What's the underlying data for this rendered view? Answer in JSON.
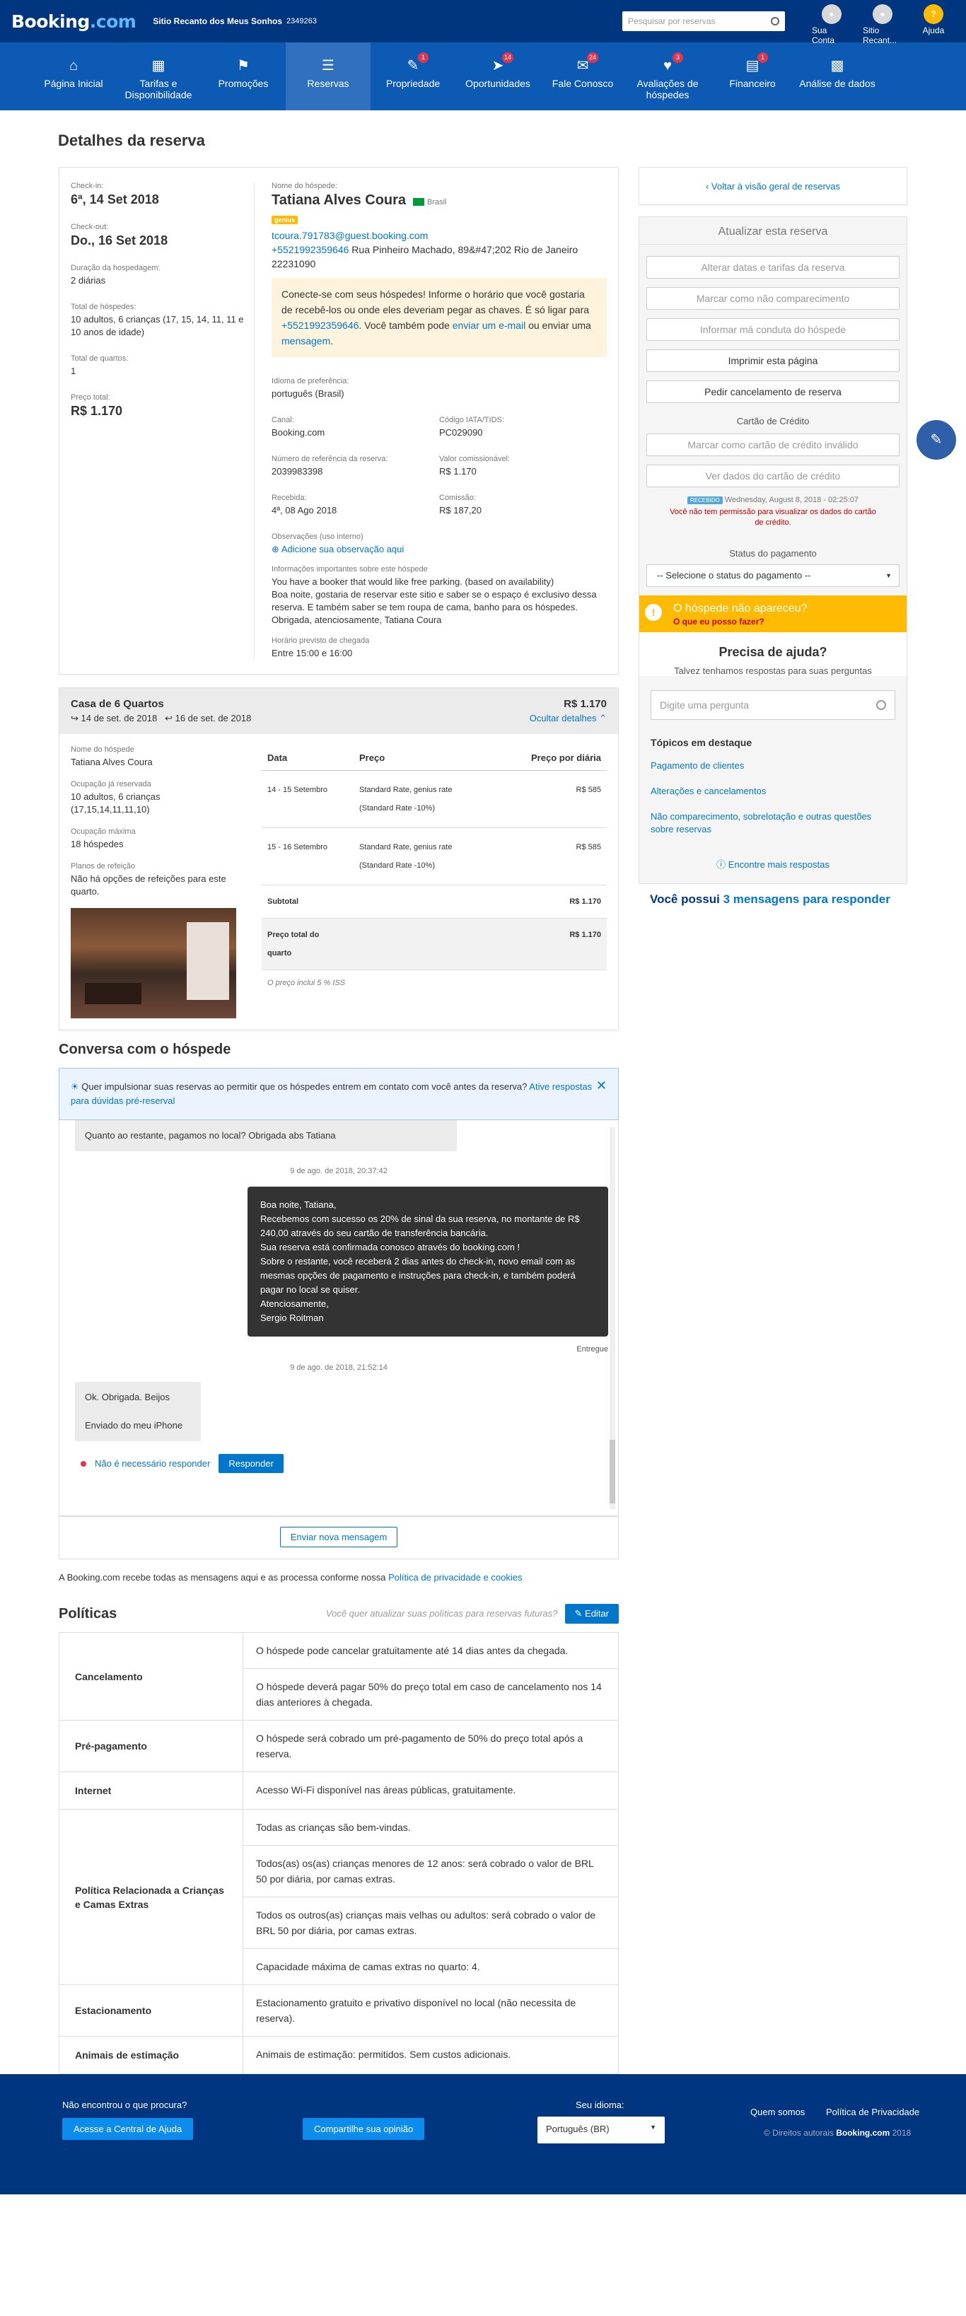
{
  "header": {
    "logo": "Booking",
    "logo_suffix": ".com",
    "property_name": "Sitio Recanto dos Meus Sonhos",
    "property_id": "2349263",
    "search_placeholder": "Pesquisar por reservas",
    "account": "Sua Conta",
    "property_short": "Sitio Recant...",
    "help": "Ajuda"
  },
  "nav": [
    {
      "label": "Página Inicial",
      "icon": "home-icon"
    },
    {
      "label": "Tarifas e Disponibilidade",
      "icon": "calendar-icon"
    },
    {
      "label": "Promoções",
      "icon": "tag-icon"
    },
    {
      "label": "Reservas",
      "icon": "list-icon"
    },
    {
      "label": "Propriedade",
      "icon": "pen-icon",
      "badge": "1"
    },
    {
      "label": "Oportunidades",
      "icon": "rocket-icon",
      "badge": "14"
    },
    {
      "label": "Fale Conosco",
      "icon": "envelope-icon",
      "badge": "24"
    },
    {
      "label": "Avaliações de hóspedes",
      "icon": "heart-icon",
      "badge": "3"
    },
    {
      "label": "Financeiro",
      "icon": "document-icon",
      "badge": "1"
    },
    {
      "label": "Análise de dados",
      "icon": "bar-chart-icon"
    }
  ],
  "page_title": "Detalhes da reserva",
  "reservation": {
    "checkin_label": "Check-in:",
    "checkin": "6ª, 14 Set 2018",
    "checkout_label": "Check-out:",
    "checkout": "Do., 16 Set 2018",
    "duration_label": "Duração da hospedagem:",
    "duration": "2 diárias",
    "guests_label": "Total de hóspedes:",
    "guests": "10 adultos, 6 crianças (17, 15, 14, 11, 11 e 10 anos de idade)",
    "rooms_label": "Total de quartos:",
    "rooms": "1",
    "price_label": "Preço total:",
    "price": "R$ 1.170",
    "guest_name_label": "Nome do hóspede:",
    "guest_name": "Tatiana Alves Coura",
    "country": "Brasil",
    "genius": "genius",
    "email": "tcoura.791783@guest.booking.com",
    "phone": "+5521992359646",
    "address": "Rua Pinheiro Machado, 89&#47;202 Rio de Janeiro 22231090",
    "notice_1": "Conecte-se com seus hóspedes! Informe o horário que você gostaria de recebê-los ou onde eles deveriam pegar as chaves. É só ligar para",
    "notice_phone": "+5521992359646",
    "notice_2": ". Você também pode",
    "notice_link1": "enviar um e-mail",
    "notice_3": "ou enviar uma",
    "notice_link2": "mensagem",
    "lang_label": "Idioma de preferência:",
    "lang": "português (Brasil)",
    "channel_label": "Canal:",
    "channel": "Booking.com",
    "iata_label": "Código IATA/TIDS:",
    "iata": "PC029090",
    "ref_label": "Número de referência da reserva:",
    "ref": "2039983398",
    "commissionable_label": "Valor comissionável:",
    "commissionable": "R$ 1.170",
    "received_label": "Recebida:",
    "received": "4ª, 08 Ago 2018",
    "commission_label": "Comissão:",
    "commission": "R$ 187,20",
    "obs_label": "Observações (uso interno)",
    "obs_link": "Adicione sua observação aqui",
    "info_label": "Informações importantes sobre este hóspede",
    "info": "You have a booker that would like free parking. (based on availability)\nBoa noite, gostaria de reservar este sitio e saber se o espaço é exclusivo dessa reserva.  E também saber se tem roupa de cama, banho para os hóspedes. Obrigada, atenciosamente, Tatiana Coura",
    "arrival_label": "Horário previsto de chegada",
    "arrival": "Entre 15:00 e 16:00"
  },
  "room": {
    "title": "Casa de 6 Quartos",
    "price": "R$ 1.170",
    "from": "14 de set. de 2018",
    "to": "16 de set. de 2018",
    "hide": "Ocultar detalhes",
    "guest_label": "Nome do hóspede",
    "guest": "Tatiana Alves Coura",
    "occ_label": "Ocupação já reservada",
    "occ": "10 adultos, 6 crianças (17,15,14,11,11,10)",
    "max_label": "Ocupação máxima",
    "max": "18 hóspedes",
    "meal_label": "Planos de refeição",
    "meal": "Não há opções de refeições para este quarto.",
    "table_head": [
      "Data",
      "Preço",
      "Preço por diária"
    ],
    "rows": [
      [
        "14 - 15 Setembro",
        "Standard Rate, genius rate (Standard Rate -10%)",
        "R$ 585"
      ],
      [
        "15 - 16 Setembro",
        "Standard Rate, genius rate (Standard Rate -10%)",
        "R$ 585"
      ]
    ],
    "subtotal_label": "Subtotal",
    "subtotal": "R$ 1.170",
    "total_label": "Preço total do quarto",
    "total": "R$ 1.170",
    "tax": "O preço inclui 5 % ISS"
  },
  "conversation": {
    "title": "Conversa com o hóspede",
    "tip": "Quer impulsionar suas reservas ao permitir que os hóspedes entrem em contato com você antes da reserva?",
    "tip_link": "Ative respostas para dúvidas pré-reserval",
    "msg_in_1": "Quanto ao restante, pagamos no local? Obrigada abs Tatiana",
    "ts_1": "9 de ago. de 2018, 20:37:42",
    "msg_out": "Boa noite, Tatiana,\nRecebemos com sucesso os 20% de sinal da sua reserva, no montante de R$ 240,00 através do seu cartão de transferência bancária.\nSua reserva está confirmada conosco através do booking.com !\nSobre o restante, você receberá 2 dias antes do check-in, novo email com as mesmas opções de pagamento e instruções para check-in, e também poderá pagar no local se quiser.\nAtenciosamente,\nSergio Roitman",
    "delivered": "Entregue",
    "ts_2": "9 de ago. de 2018, 21:52:14",
    "msg_in_2": "Ok. Obrigada. Beijos\n\nEnviado do meu iPhone",
    "no_reply": "Não é necessário responder",
    "reply": "Responder",
    "new_msg": "Enviar nova mensagem",
    "privacy": "A Booking.com recebe todas as mensagens aqui e as processa conforme nossa",
    "privacy_link": "Política de privacidade e cookies"
  },
  "policies": {
    "title": "Políticas",
    "hint": "Você quer atualizar suas políticas para reservas futuras?",
    "edit": "Editar",
    "rows": [
      {
        "k": "Cancelamento",
        "v": [
          "O hóspede pode cancelar gratuitamente até 14 dias antes da chegada.",
          "O hóspede deverá pagar 50% do preço total em caso de cancelamento nos 14 dias anteriores à chegada."
        ]
      },
      {
        "k": "Pré-pagamento",
        "v": [
          "O hóspede será cobrado um pré-pagamento de 50% do preço total após a reserva."
        ]
      },
      {
        "k": "Internet",
        "v": [
          "Acesso Wi-Fi disponível nas áreas públicas, gratuitamente."
        ]
      },
      {
        "k": "Política Relacionada a Crianças e Camas Extras",
        "v": [
          "Todas as crianças são bem-vindas.",
          "Todos(as) os(as) crianças menores de 12 anos: será cobrado o valor de BRL 50 por diária, por camas extras.",
          "Todos os outros(as) crianças mais velhas ou adultos: será cobrado o valor de BRL 50 por diária, por camas extras.",
          "Capacidade máxima de camas extras no quarto: 4."
        ]
      },
      {
        "k": "Estacionamento",
        "v": [
          "Estacionamento gratuito e privativo disponível no local (não necessita de reserva)."
        ]
      },
      {
        "k": "Animais de estimação",
        "v": [
          "Animais de estimação: permitidos. Sem custos adicionais."
        ]
      }
    ]
  },
  "sidebar": {
    "back": "Voltar à visão geral de reservas",
    "update_title": "Atualizar esta reserva",
    "buttons": [
      "Alterar datas e tarifas da reserva",
      "Marcar como não comparecimento",
      "Informar má conduta do hóspede"
    ],
    "print": "Imprimir esta página",
    "cancel": "Pedir cancelamento de reserva",
    "cc_title": "Cartão de Crédito",
    "cc_buttons": [
      "Marcar como cartão de crédito inválido",
      "Ver dados do cartão de crédito"
    ],
    "cc_badge": "RECEBIDO",
    "cc_date": "Wednesday, August 8, 2018 - 02:25:07",
    "cc_warning": "Você não tem permissão para visualizar os dados do cartão de crédito.",
    "pay_title": "Status do pagamento",
    "pay_select": "-- Selecione o status do pagamento --",
    "noshow_title": "O hóspede não apareceu?",
    "noshow_link": "O que eu posso fazer?",
    "help_title": "Precisa de ajuda?",
    "help_sub": "Talvez tenhamos respostas para suas perguntas",
    "help_placeholder": "Digite uma pergunta",
    "topics_title": "Tópicos em destaque",
    "topics": [
      "Pagamento de clientes",
      "Alterações e cancelamentos",
      "Não comparecimento, sobrelotação e outras questões sobre reservas"
    ],
    "more": "Encontre mais respostas",
    "msgs_pre": "Você possui",
    "msgs_link": "3 mensagens para responder"
  },
  "footer": {
    "q": "Não encontrou o que procura?",
    "help_btn": "Acesse a Central de Ajuda",
    "share_btn": "Compartilhe sua opinião",
    "lang_label": "Seu idioma:",
    "lang": "Português (BR)",
    "about": "Quem somos",
    "privacy": "Política de Privacidade",
    "copyright": "© Direitos autorais",
    "brand": "Booking.com",
    "year": "2018"
  },
  "colors": {
    "header": "#003580",
    "nav": "#0c5ab4",
    "accent": "#0077cc",
    "noshow": "#febb02"
  }
}
